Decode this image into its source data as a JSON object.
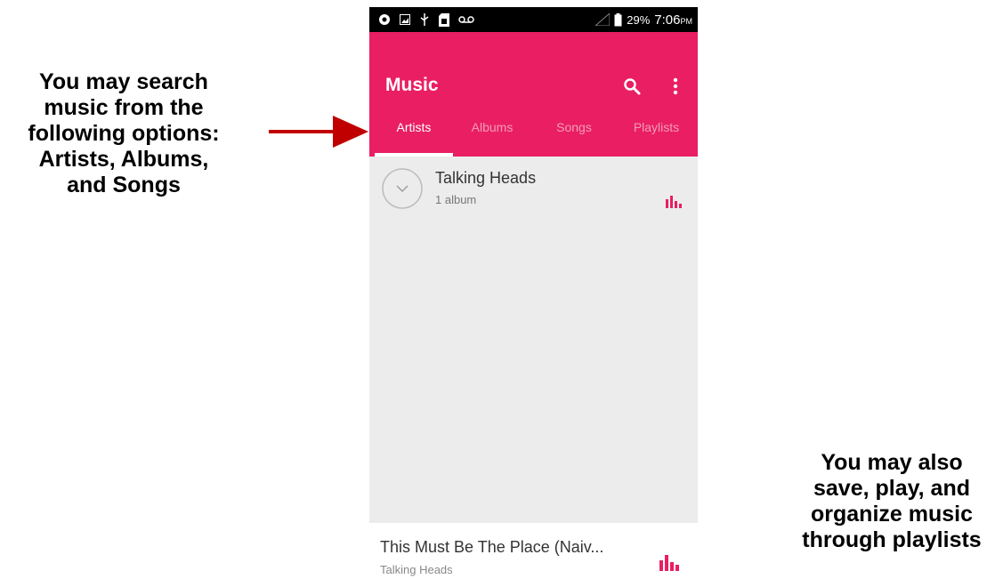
{
  "annotations": {
    "left_lines": [
      "You may search",
      "music from the",
      "following options:",
      "Artists, Albums,",
      "and Songs"
    ],
    "right_lines": [
      "You may also",
      "save, play, and",
      "organize music",
      "through playlists"
    ],
    "arrow_color": "#c00000"
  },
  "status_bar": {
    "battery": "29%",
    "time": "7:06",
    "ampm": "PM",
    "icons": [
      "circle-icon",
      "image-icon",
      "usb-icon",
      "sim-icon",
      "voicemail-icon",
      "signal-icon",
      "battery-icon"
    ]
  },
  "app_bar": {
    "title": "Music",
    "color": "#e91e63",
    "actions": [
      "search-icon",
      "more-vert-icon"
    ]
  },
  "tabs": [
    {
      "label": "Artists",
      "active": true
    },
    {
      "label": "Albums",
      "active": false
    },
    {
      "label": "Songs",
      "active": false
    },
    {
      "label": "Playlists",
      "active": false
    }
  ],
  "artists": [
    {
      "name": "Talking Heads",
      "meta": "1 album"
    }
  ],
  "now_playing": {
    "title": "This Must Be The Place (Naiv...",
    "artist": "Talking Heads"
  }
}
